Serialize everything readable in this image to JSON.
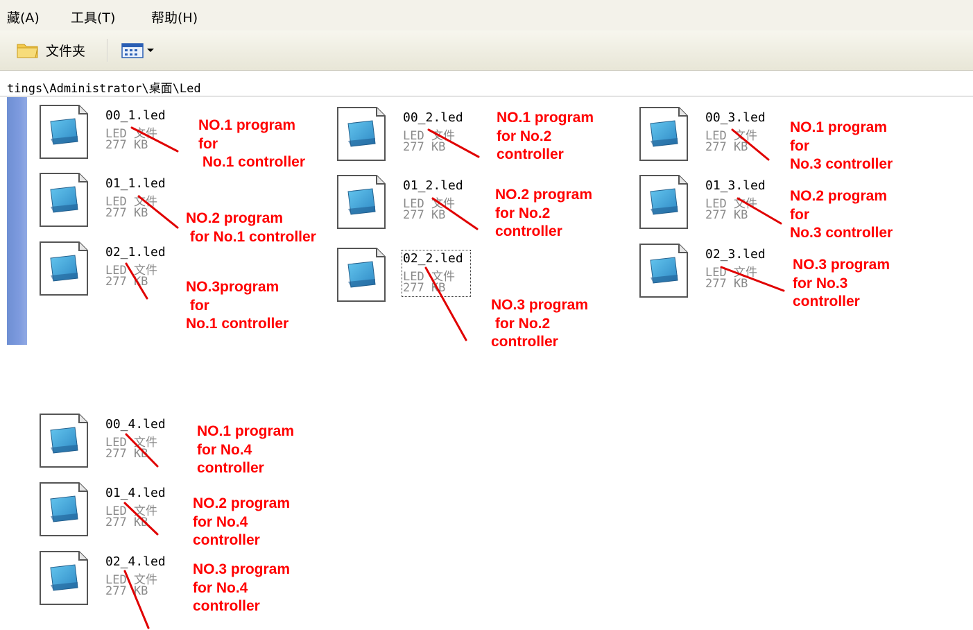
{
  "menu": [
    "藏(A)",
    "工具(T)",
    "帮助(H)"
  ],
  "toolbar": {
    "folders_label": "文件夹"
  },
  "address": {
    "path": "tings\\Administrator\\桌面\\Led"
  },
  "file_type": "LED 文件",
  "file_size": "277 KB",
  "files": [
    {
      "name": "00_1.led"
    },
    {
      "name": "01_1.led"
    },
    {
      "name": "02_1.led"
    },
    {
      "name": "00_2.led"
    },
    {
      "name": "01_2.led"
    },
    {
      "name": "02_2.led"
    },
    {
      "name": "00_3.led"
    },
    {
      "name": "01_3.led"
    },
    {
      "name": "02_3.led"
    },
    {
      "name": "00_4.led"
    },
    {
      "name": "01_4.led"
    },
    {
      "name": "02_4.led"
    }
  ],
  "notes": [
    "NO.1 program\nfor\n No.1 controller",
    "NO.2 program\n for No.1 controller",
    "NO.3program\n for\nNo.1 controller",
    "NO.1 program\nfor No.2\ncontroller",
    "NO.2 program\nfor No.2\ncontroller",
    "NO.3 program\n for No.2\ncontroller",
    "NO.1 program\nfor\nNo.3 controller",
    "NO.2 program\nfor\nNo.3 controller",
    "NO.3 program\nfor No.3\ncontroller",
    "NO.1 program\nfor No.4\ncontroller",
    "NO.2 program\nfor No.4\ncontroller",
    "NO.3 program\nfor No.4\ncontroller"
  ],
  "colors": {
    "annotation": "#ff0000",
    "sidebar": "#7d9ade",
    "icon_screen": "#3aa7d6"
  }
}
